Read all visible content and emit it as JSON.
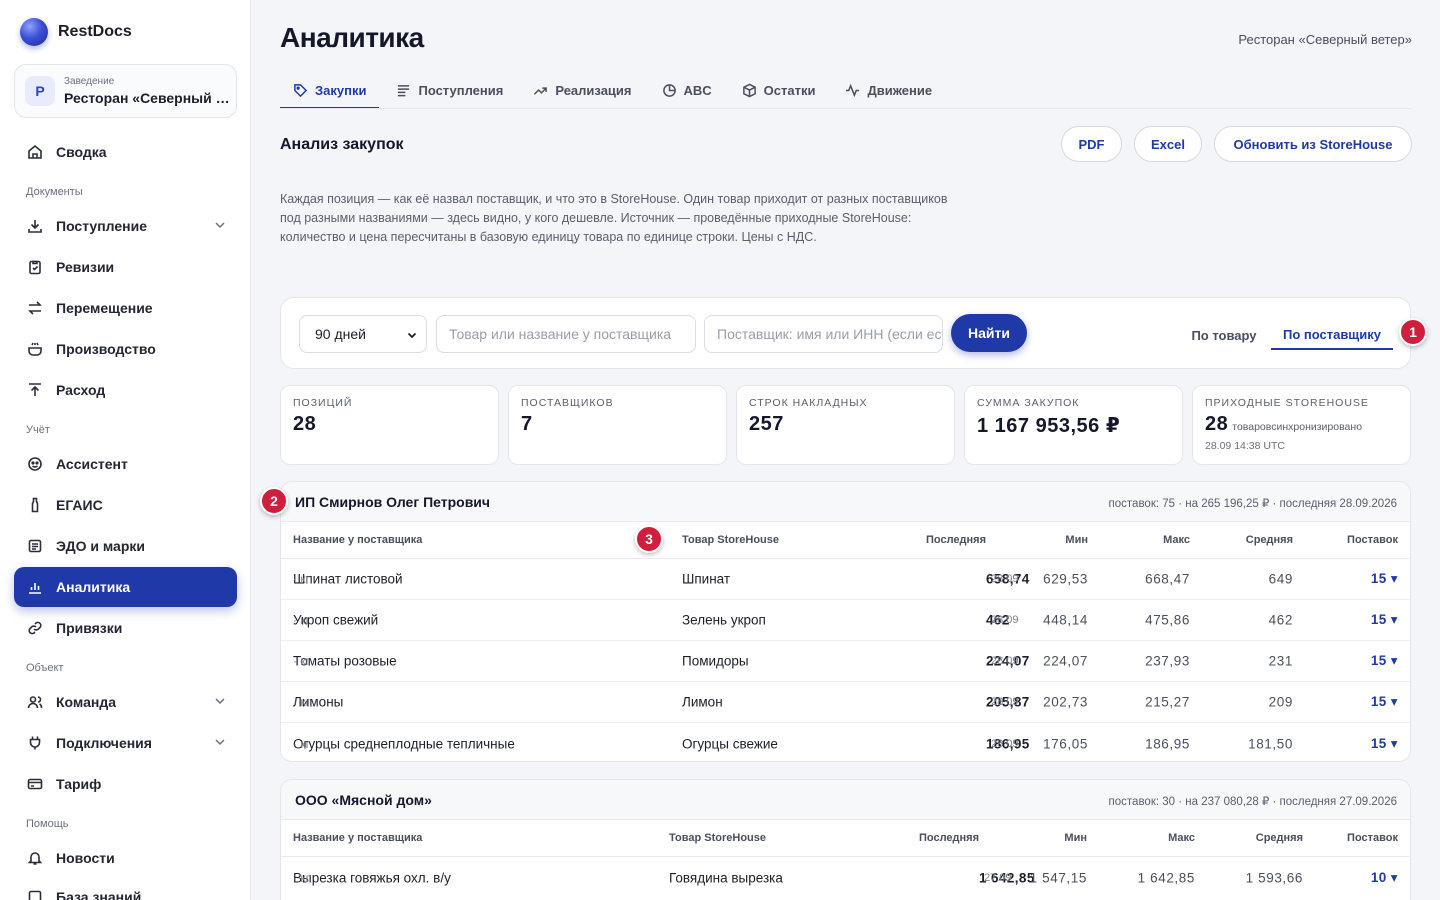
{
  "brand": {
    "name": "RestDocs"
  },
  "venue": {
    "label": "Заведение",
    "avatar": "Р",
    "name": "Ресторан «Северный ветер»"
  },
  "sidebar": {
    "items": [
      {
        "label": "Сводка",
        "icon": "home-icon"
      },
      {
        "section": "Документы"
      },
      {
        "label": "Поступление",
        "icon": "download-icon",
        "expandable": true
      },
      {
        "label": "Ревизии",
        "icon": "clipboard-icon"
      },
      {
        "label": "Перемещение",
        "icon": "transfer-icon"
      },
      {
        "label": "Производство",
        "icon": "cooking-pot-icon"
      },
      {
        "label": "Расход",
        "icon": "upload-icon"
      },
      {
        "section": "Учёт"
      },
      {
        "label": "Ассистент",
        "icon": "assistant-icon"
      },
      {
        "label": "ЕГАИС",
        "icon": "bottle-icon"
      },
      {
        "label": "ЭДО и марки",
        "icon": "document-icon"
      },
      {
        "label": "Аналитика",
        "icon": "chart-icon",
        "active": true
      },
      {
        "label": "Привязки",
        "icon": "link-icon"
      },
      {
        "section": "Объект"
      },
      {
        "label": "Команда",
        "icon": "users-icon",
        "expandable": true
      },
      {
        "label": "Подключения",
        "icon": "plug-icon",
        "expandable": true
      },
      {
        "label": "Тариф",
        "icon": "credit-card-icon"
      },
      {
        "section": "Помощь"
      },
      {
        "label": "Новости",
        "icon": "bell-icon"
      },
      {
        "label": "База знаний",
        "icon": "book-icon"
      }
    ]
  },
  "header": {
    "title": "Аналитика",
    "restaurant": "Ресторан «Северный ветер»"
  },
  "tabs": [
    {
      "label": "Закупки",
      "icon": "tag-icon",
      "active": true
    },
    {
      "label": "Поступления",
      "icon": "list-icon"
    },
    {
      "label": "Реализация",
      "icon": "trend-icon"
    },
    {
      "label": "ABC",
      "icon": "pie-icon"
    },
    {
      "label": "Остатки",
      "icon": "box-icon"
    },
    {
      "label": "Движение",
      "icon": "pulse-icon"
    }
  ],
  "section": {
    "title": "Анализ закупок",
    "buttons": {
      "pdf": "PDF",
      "excel": "Excel",
      "refresh": "Обновить из StoreHouse"
    },
    "description": "Каждая позиция — как её назвал поставщик, и что это в StoreHouse. Один товар приходит от разных поставщиков под разными названиями — здесь видно, у кого дешевле. Источник — проведённые приходные StoreHouse: количество и цена пересчитаны в базовую единицу товара по единице строки. Цены с НДС."
  },
  "filters": {
    "period": "90 дней",
    "product_placeholder": "Товар или название у поставщика",
    "supplier_placeholder": "Поставщик: имя или ИНН (если есть)",
    "find": "Найти",
    "by_product": "По товару",
    "by_supplier": "По поставщику"
  },
  "badges": [
    "1",
    "2",
    "3"
  ],
  "kpis": [
    {
      "label": "Позиций",
      "value": "28"
    },
    {
      "label": "Поставщиков",
      "value": "7"
    },
    {
      "label": "Строк накладных",
      "value": "257"
    },
    {
      "label": "Сумма закупок",
      "value": "1 167 953,56 ₽"
    },
    {
      "label": "Приходные StoreHouse",
      "value": "28",
      "sub": "товаров",
      "sub2": "синхронизировано",
      "note": "28.09 14:38 UTC"
    }
  ],
  "columns": {
    "name": "Название у поставщика",
    "product": "Товар StoreHouse",
    "last": "Последняя",
    "min": "Мин",
    "max": "Макс",
    "avg": "Средняя",
    "deliveries": "Поставок"
  },
  "suppliers": [
    {
      "name": "ИП Смирнов Олег Петрович",
      "meta": "поставок: 75 · на 265 196,25 ₽ · последняя 28.09.2026",
      "rows": [
        {
          "name": "Шпинат листовой",
          "unit": " · кг",
          "product": "Шпинат",
          "last": "658,74",
          "date": "28.09",
          "min": "629,53",
          "max": "668,47",
          "avg": "649",
          "deliveries": "15 ▾"
        },
        {
          "name": "Укроп свежий",
          "unit": " · кг",
          "product": "Зелень укроп",
          "last": "462",
          "date": "28.09",
          "min": "448,14",
          "max": "475,86",
          "avg": "462",
          "deliveries": "15 ▾"
        },
        {
          "name": "Томаты розовые",
          "unit": " · кг",
          "product": "Помидоры",
          "last": "224,07",
          "date": "28.09",
          "min": "224,07",
          "max": "237,93",
          "avg": "231",
          "deliveries": "15 ▾"
        },
        {
          "name": "Лимоны",
          "unit": " · кг",
          "product": "Лимон",
          "last": "205,87",
          "date": "28.09",
          "min": "202,73",
          "max": "215,27",
          "avg": "209",
          "deliveries": "15 ▾"
        },
        {
          "name": "Огурцы среднеплодные тепличные",
          "unit": " · кг",
          "product": "Огурцы свежие",
          "last": "186,95",
          "date": "28.09",
          "min": "176,05",
          "max": "186,95",
          "avg": "181,50",
          "deliveries": "15 ▾"
        }
      ]
    },
    {
      "name": "ООО «Мясной дом»",
      "meta": "поставок: 30 · на 237 080,28 ₽ · последняя 27.09.2026",
      "rows": [
        {
          "name": "Вырезка говяжья охл. в/у",
          "unit": " · кг",
          "product": "Говядина вырезка",
          "last": "1 642,85",
          "date": "27.09",
          "min": "1 547,15",
          "max": "1 642,85",
          "avg": "1 593,66",
          "deliveries": "10 ▾"
        }
      ]
    }
  ]
}
